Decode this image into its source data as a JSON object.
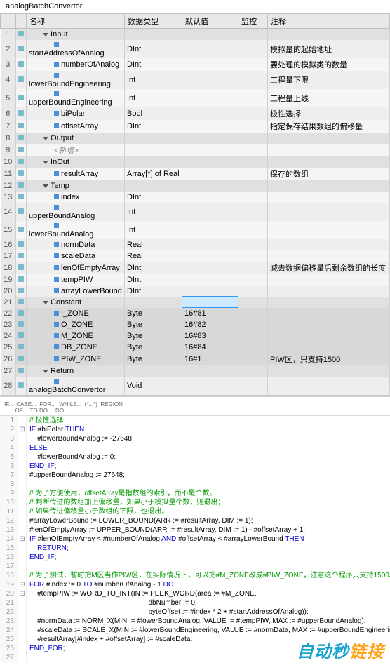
{
  "title": "analogBatchConvertor",
  "headers": {
    "name": "名称",
    "type": "数据类型",
    "default": "默认值",
    "monitor": "监控",
    "comment": "注释"
  },
  "groups": {
    "input": "Input",
    "output": "Output",
    "inout": "InOut",
    "temp": "Temp",
    "constant": "Constant",
    "return": "Return"
  },
  "rows": {
    "r2": {
      "name": "startAddressOfAnalog",
      "type": "DInt",
      "comment": "模拟量的起始地址"
    },
    "r3": {
      "name": "numberOfAnalog",
      "type": "DInt",
      "comment": "要处理的模拟类的数量"
    },
    "r4": {
      "name": "lowerBoundEngineering",
      "type": "Int",
      "comment": "工程量下限"
    },
    "r5": {
      "name": "upperBoundEngineering",
      "type": "Int",
      "comment": "工程量上线"
    },
    "r6": {
      "name": "biPolar",
      "type": "Bool",
      "comment": "极性选择"
    },
    "r7": {
      "name": "offsetArray",
      "type": "DInt",
      "comment": "指定保存结果数组的偏移量"
    },
    "r9": {
      "name": "<新增>"
    },
    "r11": {
      "name": "resultArray",
      "type": "Array[*] of Real",
      "comment": "保存的数组"
    },
    "r13": {
      "name": "index",
      "type": "DInt"
    },
    "r14": {
      "name": "upperBoundAnalog",
      "type": "Int"
    },
    "r15": {
      "name": "lowerBoundAnalog",
      "type": "Int"
    },
    "r16": {
      "name": "normData",
      "type": "Real"
    },
    "r17": {
      "name": "scaleData",
      "type": "Real"
    },
    "r18": {
      "name": "lenOfEmptyArray",
      "type": "DInt",
      "comment": "减去数据偏移量后剩余数组的长度"
    },
    "r19": {
      "name": "tempPIW",
      "type": "DInt"
    },
    "r20": {
      "name": "arrayLowerBound",
      "type": "DInt"
    },
    "r22": {
      "name": "I_ZONE",
      "type": "Byte",
      "default": "16#81"
    },
    "r23": {
      "name": "O_ZONE",
      "type": "Byte",
      "default": "16#82"
    },
    "r24": {
      "name": "M_ZONE",
      "type": "Byte",
      "default": "16#83"
    },
    "r25": {
      "name": "DB_ZONE",
      "type": "Byte",
      "default": "16#84"
    },
    "r26": {
      "name": "PIW_ZONE",
      "type": "Byte",
      "default": "16#1",
      "comment": "PIW区，只支持1500"
    },
    "r28": {
      "name": "analogBatchConvertor",
      "type": "Void"
    }
  },
  "toolbar": "IF...  CASE...  FOR...  WHILE...  (*...*)  REGION\n       OF...  TO DO...  DO...",
  "code": [
    {
      "n": 1,
      "f": "",
      "cm": true,
      "t": "// 极性选择"
    },
    {
      "n": 2,
      "f": "⊟",
      "t": "IF #biPolar THEN",
      "kw": [
        "IF",
        "THEN"
      ]
    },
    {
      "n": 3,
      "f": "",
      "t": "    #lowerBoundAnalog := -27648;"
    },
    {
      "n": 4,
      "f": "",
      "t": "ELSE",
      "kw": [
        "ELSE"
      ]
    },
    {
      "n": 5,
      "f": "",
      "t": "    #lowerBoundAnalog := 0;"
    },
    {
      "n": 6,
      "f": "",
      "t": "END_IF;",
      "kw": [
        "END_IF"
      ]
    },
    {
      "n": 7,
      "f": "",
      "t": "#upperBoundAnalog := 27648;"
    },
    {
      "n": 8,
      "f": "",
      "t": ""
    },
    {
      "n": 9,
      "f": "",
      "cm": true,
      "t": "// 为了方便使用，offsetArray是指数组的索引，而不是个数。"
    },
    {
      "n": 10,
      "f": "",
      "cm": true,
      "t": "// 判断传进的数组加上偏移量，如果小于模拟量个数，则退出；"
    },
    {
      "n": 11,
      "f": "",
      "cm": true,
      "t": "// 如果传进偏移量小于数组的下限，也退出。"
    },
    {
      "n": 12,
      "f": "",
      "t": "#arrayLowerBound := LOWER_BOUND(ARR := #resultArray, DIM := 1);"
    },
    {
      "n": 13,
      "f": "",
      "t": "#lenOfEmptyArray := UPPER_BOUND(ARR := #resultArray, DIM := 1) - #offsetArray + 1;"
    },
    {
      "n": 14,
      "f": "⊟",
      "t": "IF #lenOfEmptyArray < #numberOfAnalog AND #offsetArray < #arrayLowerBound THEN",
      "kw": [
        "IF",
        "AND",
        "THEN"
      ]
    },
    {
      "n": 15,
      "f": "",
      "t": "    RETURN;",
      "kw": [
        "RETURN"
      ]
    },
    {
      "n": 16,
      "f": "",
      "t": "END_IF;",
      "kw": [
        "END_IF"
      ]
    },
    {
      "n": 17,
      "f": "",
      "t": ""
    },
    {
      "n": 18,
      "f": "",
      "cm": true,
      "t": "// 为了测试，暂时把M区当作PIW区，在实际情况下，可以把#M_ZONE改成#PIW_ZONE，注意这个程序只支持1500。"
    },
    {
      "n": 19,
      "f": "⊟",
      "t": "FOR #index := 0 TO #numberOfAnalog - 1 DO",
      "kw": [
        "FOR",
        "TO",
        "DO"
      ]
    },
    {
      "n": 20,
      "f": "⊟",
      "t": "    #tempPIW := WORD_TO_INT(IN := PEEK_WORD(area := #M_ZONE,"
    },
    {
      "n": 21,
      "f": "",
      "t": "                                                             dbNumber := 0,"
    },
    {
      "n": 22,
      "f": "",
      "t": "                                                             byteOffset := #index * 2 + #startAddressOfAnalog));"
    },
    {
      "n": 23,
      "f": "",
      "t": "    #normData := NORM_X(MIN := #lowerBoundAnalog, VALUE := #tempPIW, MAX := #upperBoundAnalog);"
    },
    {
      "n": 24,
      "f": "",
      "t": "    #scaleData := SCALE_X(MIN := #lowerBoundEngineering, VALUE := #normData, MAX := #upperBoundEngineering);"
    },
    {
      "n": 25,
      "f": "",
      "t": "    #resultArray[#index + #offsetArray] := #scaleData;"
    },
    {
      "n": 26,
      "f": "",
      "t": "END_FOR;",
      "kw": [
        "END_FOR"
      ]
    },
    {
      "n": 27,
      "f": "",
      "t": ""
    }
  ],
  "watermark": {
    "p1": "自动秒",
    "p2": "链接"
  }
}
